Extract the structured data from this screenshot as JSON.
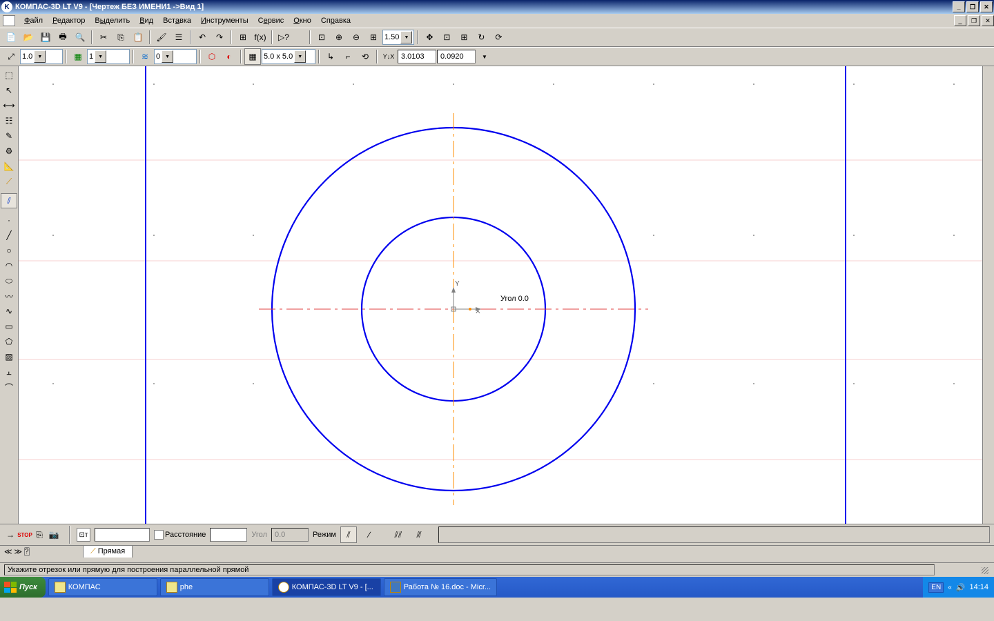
{
  "title": "КОМПАС-3D LT V9 - [Чертеж БЕЗ ИМЕНИ1 ->Вид 1]",
  "menu": {
    "file": "Файл",
    "editor": "Редактор",
    "select": "Выделить",
    "view": "Вид",
    "insert": "Вставка",
    "tools": "Инструменты",
    "service": "Сервис",
    "window": "Окно",
    "help": "Справка"
  },
  "toolbar1": {
    "zoom": "1.50"
  },
  "toolbar2": {
    "step": "1.0",
    "layer_sel": "1",
    "layer_num": "0",
    "grid": "5.0 x 5.0",
    "coord_x": "3.0103",
    "coord_y": "0.0920"
  },
  "canvas": {
    "axis_y": "Y",
    "axis_x": "X",
    "angle_label": "Угол 0.0"
  },
  "props": {
    "distance_label": "Расстояние",
    "distance_value": "",
    "angle_label": "Угол",
    "angle_value": "0.0",
    "mode_label": "Режим"
  },
  "tab": "Прямая",
  "hint": "Укажите отрезок или прямую для построения параллельной прямой",
  "taskbar": {
    "start": "Пуск",
    "items": [
      "КОМПАС",
      "phe",
      "КОМПАС-3D LT V9 - [...",
      "Работа № 16.doc - Micr..."
    ],
    "lang": "EN",
    "time": "14:14"
  }
}
